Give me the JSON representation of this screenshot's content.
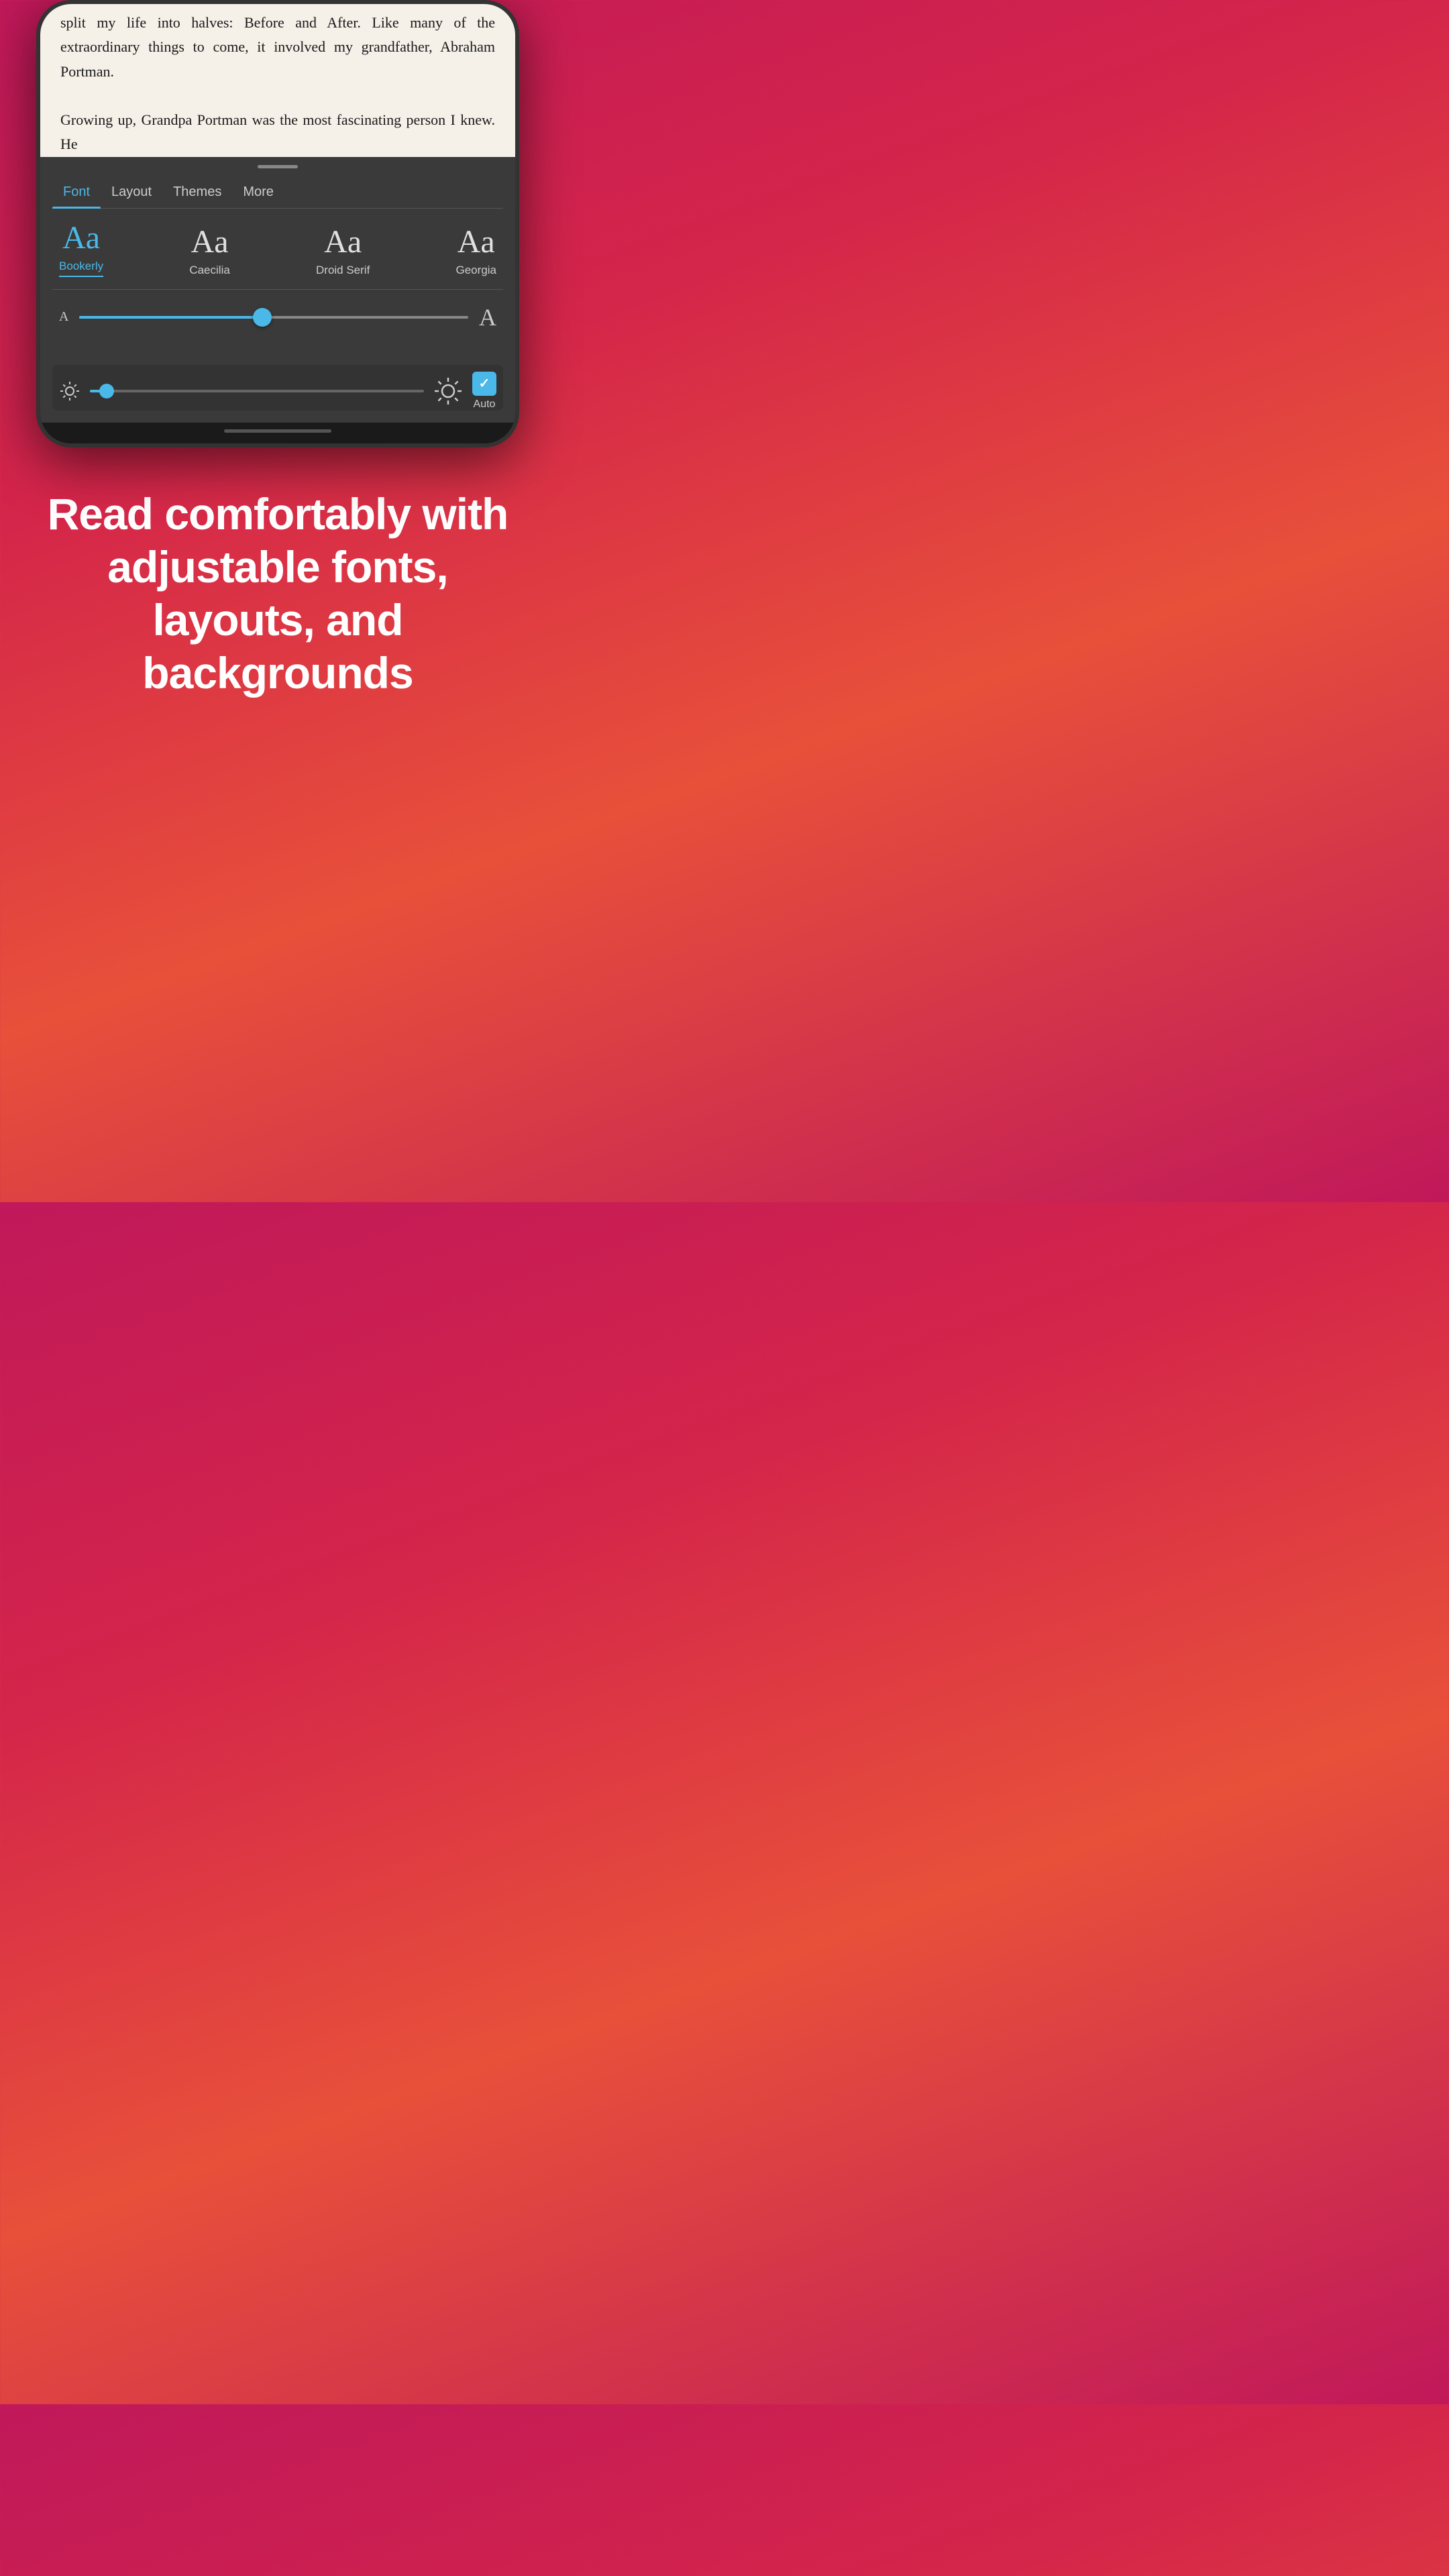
{
  "phone": {
    "reading": {
      "text": "split my life into halves: Before and After. Like many of the extraordinary things to come, it involved my grandfather, Abraham Portman.",
      "text2": "Growing up, Grandpa Portman was the most fascinating person I knew. He"
    },
    "tabs": [
      {
        "label": "Font",
        "active": true
      },
      {
        "label": "Layout",
        "active": false
      },
      {
        "label": "Themes",
        "active": false
      },
      {
        "label": "More",
        "active": false
      }
    ],
    "fonts": [
      {
        "sample": "Aa",
        "name": "Bookerly",
        "selected": true,
        "fontClass": "font-bookerly"
      },
      {
        "sample": "Aa",
        "name": "Caecilia",
        "selected": false,
        "fontClass": "font-caecilia"
      },
      {
        "sample": "Aa",
        "name": "Droid Serif",
        "selected": false,
        "fontClass": "font-droid"
      },
      {
        "sample": "Aa",
        "name": "Georgia",
        "selected": false,
        "fontClass": "font-georgia"
      }
    ],
    "sizeSlider": {
      "smallLabel": "A",
      "largeLabel": "A",
      "fillPercent": 47
    },
    "brightness": {
      "fillPercent": 5,
      "autoLabel": "Auto"
    }
  },
  "tagline": "Read comfortably with adjustable fonts, layouts, and backgrounds"
}
